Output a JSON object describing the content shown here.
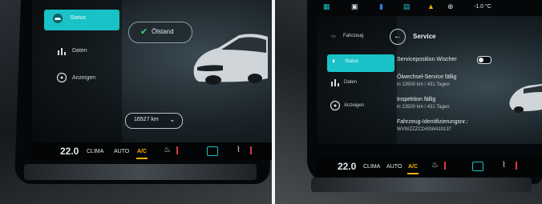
{
  "left_screen": {
    "nav": {
      "status": "Status",
      "daten": "Daten",
      "anzeigen": "Anzeigen"
    },
    "oil_pill": "Ölstand",
    "odometer": "16527 km"
  },
  "right_screen": {
    "statusbar": {
      "temperature": "-1.0 °C"
    },
    "nav": {
      "fahrzeug": "Fahrzeug",
      "status": "Status",
      "daten": "Daten",
      "anzeigen": "Anzeigen"
    },
    "title": "Service",
    "service_wiper": "Serviceposition Wischer",
    "oil_service_title": "Ölwechsel-Service fällig",
    "oil_service_sub": "in 13500 km / 431 Tagen",
    "inspection_title": "Inspektion fällig",
    "inspection_sub": "in 13500 km / 431 Tagen",
    "vin_title": "Fahrzeug-Identifizierungsnr.:",
    "vin_value": "WVWZZZCD4SW410137"
  },
  "climate_bar": {
    "temperature": "22.0",
    "clima": "CLIMA",
    "auto": "AUTO",
    "ac": "A/C"
  },
  "icons": {
    "status": "car-status-icon",
    "daten": "bar-chart-icon",
    "anzeigen": "display-icon",
    "back": "back-arrow-icon",
    "seat_heat": "seat-heat-icon",
    "defrost": "defrost-icon"
  },
  "colors": {
    "accent": "#19c2c6",
    "ac_active": "#ffb000",
    "check": "#45d46a"
  }
}
